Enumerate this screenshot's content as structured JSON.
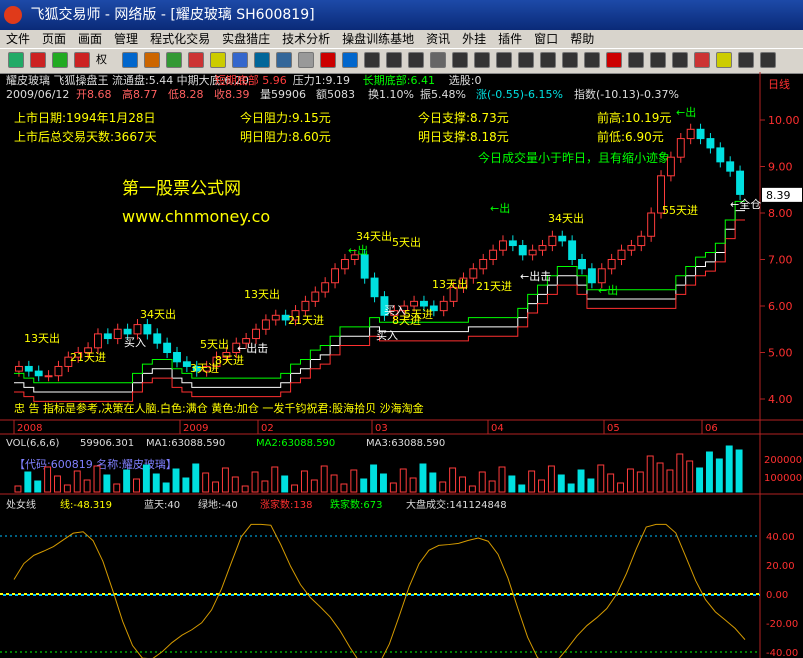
{
  "window": {
    "title": "飞狐交易师 - 网络版 - [耀皮玻璃 SH600819]"
  },
  "menu": [
    "文件",
    "页面",
    "画面",
    "管理",
    "程式化交易",
    "实盘猎庄",
    "技术分析",
    "操盘训练基地",
    "资讯",
    "外挂",
    "插件",
    "窗口",
    "帮助"
  ],
  "toolbar": {
    "quan_label": "权"
  },
  "header": {
    "line1": "耀皮玻璃 飞狐操盘王 流通盘:5.44 中期大底:6.20",
    "line1_red": "短期底部 5.96",
    "line1_b": "压力1:9.19",
    "line1_green": "长期底部:6.41",
    "line1_c": "选股:0",
    "line2a": "2009/06/12",
    "line2b": "开8.68",
    "line2c": "高8.77",
    "line2d": "低8.28",
    "line2e": "收8.39",
    "line2f": "量59906",
    "line2g": "额5083",
    "line2h": "换1.10%",
    "line2i": "振5.48%",
    "line2j": "涨(-0.55)-6.15%",
    "line2k": "指数(-10.13)-0.37%"
  },
  "info": {
    "list_date": "上市日期:1994年1月28日",
    "trade_days": "上市后总交易天数:3667天",
    "today_resist": "今日阻力:9.15元",
    "tomorrow_resist": "明日阻力:8.60元",
    "today_support": "今日支撑:8.73元",
    "tomorrow_support": "明日支撑:8.18元",
    "prev_high": "前高:10.19元",
    "prev_low": "前低:6.90元",
    "volume_note": "今日成交量小于昨日，且有缩小迹象"
  },
  "watermark": {
    "title": "第一股票公式网",
    "url": "www.chnmoney.co"
  },
  "annotations": {
    "d13_1": "13天出",
    "d21_1": "21天进",
    "d34_1": "34天出",
    "buy_1": "买入",
    "d5_1": "5天出",
    "d3": "3天进",
    "d8": "8天进",
    "out_1": "←出击",
    "d13_2": "13天出",
    "d21_2": "21天进",
    "d34_2": "34天出",
    "out_2": "←出",
    "d5_2": "5天出",
    "d13_3": "13天出",
    "buy_2": "买入",
    "d8_2": "8天进",
    "d5_3": "5天进",
    "buy_3": "买入",
    "d34_3": "34天出",
    "d21_3": "21天进",
    "out_3": "←出击",
    "out_4": "←出",
    "out_5": "←出",
    "out_6": "←出",
    "d55": "55天进",
    "all_in": "←全仓",
    "bottom_note": "忠 告 指标是参考,决策在人脑.白色:满仓  黄色:加仓   一发千钧祝君:股海拾贝 沙海淘金"
  },
  "price_axis": {
    "labels": [
      "10.00",
      "9.00",
      "8.00",
      "7.00",
      "6.00",
      "5.00",
      "4.00"
    ],
    "current": "8.39",
    "unit": "日线"
  },
  "date_axis": {
    "labels": [
      "2008",
      "2009",
      "02",
      "03",
      "04",
      "05",
      "06"
    ]
  },
  "volume": {
    "header_a": "VOL(6,6,6)",
    "header_b": "59906.301",
    "header_c": "MA1:63088.590",
    "header_d": "MA2:63088.590",
    "header_e": "MA3:63088.590",
    "code_line": "【代码:600819 名称:耀皮玻璃】",
    "axis_labels": [
      "200000",
      "100000"
    ]
  },
  "indicator": {
    "name": "处女线",
    "line": "线:-48.319",
    "blue_sky": "蓝天:40",
    "green_land": "绿地:-40",
    "up_count": "涨家数:138",
    "down_count": "跌家数:673",
    "market_vol": "大盘成交:141124848",
    "axis_labels": [
      "40.00",
      "20.00",
      "0.00",
      "-20.00",
      "-40.00"
    ]
  },
  "colors": {
    "up": "#ff3c3c",
    "down": "#00e0e0",
    "grid": "#8b0000",
    "axis": "#b22222",
    "yellow": "#ffff00",
    "green": "#00ff00",
    "white": "#ffffff",
    "orange": "#d49a00"
  },
  "chart_data": {
    "type": "candlestick",
    "description_values": {
      "close_approx": [
        4.7,
        4.6,
        4.5,
        4.5,
        4.7,
        4.9,
        5.0,
        5.1,
        5.4,
        5.3,
        5.5,
        5.4,
        5.6,
        5.4,
        5.2,
        5.0,
        4.8,
        4.7,
        4.6,
        4.7,
        4.9,
        5.0,
        5.2,
        5.3,
        5.5,
        5.7,
        5.8,
        5.7,
        5.9,
        6.1,
        6.3,
        6.5,
        6.8,
        7.0,
        7.1,
        6.6,
        6.2,
        5.8,
        5.9,
        6.0,
        6.1,
        6.0,
        5.9,
        6.1,
        6.4,
        6.6,
        6.8,
        7.0,
        7.2,
        7.4,
        7.3,
        7.1,
        7.2,
        7.3,
        7.5,
        7.4,
        7.0,
        6.8,
        6.5,
        6.8,
        7.0,
        7.2,
        7.3,
        7.5,
        8.0,
        8.8,
        9.2,
        9.6,
        9.8,
        9.6,
        9.4,
        9.1,
        8.9,
        8.4
      ]
    }
  }
}
